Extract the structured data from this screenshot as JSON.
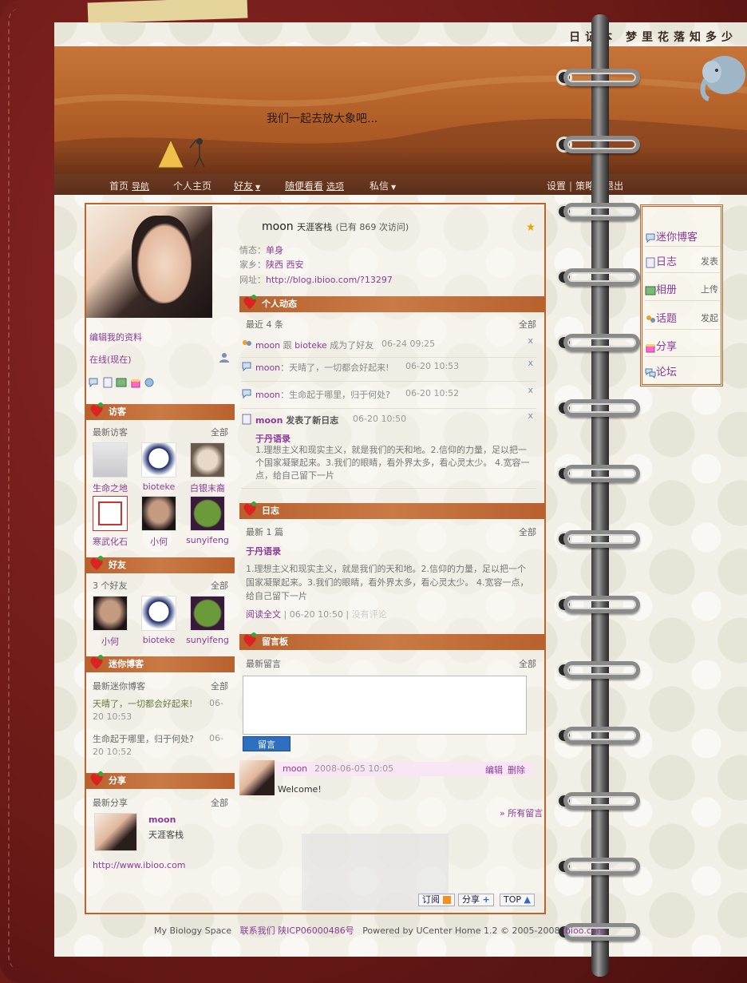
{
  "header": {
    "site_title": "日记本 梦里花落知多少",
    "slogan": "我们一起去放大象吧...",
    "nav_left": [
      {
        "label": "首页",
        "sub": "导航"
      },
      {
        "label": "个人主页"
      },
      {
        "label": "好友",
        "caret": "▼"
      },
      {
        "label": "随便看看",
        "sub": "选项"
      },
      {
        "label": "私信",
        "caret": "▼"
      }
    ],
    "nav_right": [
      "设置",
      "策略",
      "退出"
    ],
    "nav_sep": "|"
  },
  "profile": {
    "name": "moon",
    "title": "天涯客栈",
    "visits": "(已有 869 次访问)",
    "status_label": "情态：",
    "status_value": "单身",
    "hometown_label": "家乡：",
    "hometown_value": "陕西 西安",
    "url_label": "网址：",
    "url_value": "http://blog.ibioo.com/?13297",
    "edit_link": "编辑我的资料",
    "online": "在线(现在)"
  },
  "visitors": {
    "title": "访客",
    "subtitle": "最新访客",
    "all": "全部",
    "items": [
      "生命之地",
      "bioteke",
      "白银末裔",
      "寒武化石",
      "小何",
      "sunyifeng"
    ]
  },
  "friends": {
    "title": "好友",
    "subtitle": "3 个好友",
    "all": "全部",
    "items": [
      "小何",
      "bioteke",
      "sunyifeng"
    ]
  },
  "mini_blog": {
    "title": "迷你博客",
    "subtitle": "最新迷你博客",
    "all": "全部",
    "items": [
      {
        "text": "天晴了，一切都会好起来!",
        "time1": "06-",
        "time2": "20 10:53"
      },
      {
        "text": "生命起于哪里，归于何处?",
        "time1": "06-",
        "time2": "20 10:52"
      }
    ]
  },
  "share": {
    "title": "分享",
    "subtitle": "最新分享",
    "all": "全部",
    "user": "moon",
    "user_title": "天涯客栈",
    "link": "http://www.ibioo.com"
  },
  "feed": {
    "title": "个人动态",
    "subtitle": "最近 4 条",
    "all": "全部",
    "close": "x",
    "items": [
      {
        "user": "moon",
        "join": "跟",
        "target": "bioteke",
        "action": "成为了好友",
        "time": "06-24 09:25"
      },
      {
        "user": "moon",
        "text": "：天晴了，一切都会好起来!",
        "time": "06-20 10:53"
      },
      {
        "user": "moon",
        "text": "：生命起于哪里，归于何处?",
        "time": "06-20 10:52"
      },
      {
        "user": "moon",
        "action": "发表了新日志",
        "time": "06-20 10:50"
      }
    ],
    "post_title": "于丹语录",
    "post_body": "1.理想主义和现实主义，就是我们的天和地。2.信仰的力量，足以把一个国家凝聚起来。3.我们的眼睛，看外界太多，看心灵太少。 4.宽容一点，给自己留下一片"
  },
  "diary": {
    "title": "日志",
    "subtitle": "最新 1 篇",
    "all": "全部",
    "post_title": "于丹语录",
    "post_body": "1.理想主义和现实主义，就是我们的天和地。2.信仰的力量，足以把一个国家凝聚起来。3.我们的眼睛，看外界太多，看心灵太少。 4.宽容一点，给自己留下一片",
    "read_more": "阅读全文",
    "time": "06-20 10:50",
    "sep": "|",
    "comments": "没有评论"
  },
  "guestbook": {
    "title": "留言板",
    "subtitle": "最新留言",
    "all": "全部",
    "submit": "留言",
    "entry_user": "moon",
    "entry_time": "2008-06-05 10:05",
    "entry_edit": "编辑",
    "entry_delete": "删除",
    "entry_text": "Welcome!",
    "all_link": "» 所有留言"
  },
  "sidebar": {
    "items": [
      {
        "label": "迷你博客",
        "aux": ""
      },
      {
        "label": "日志",
        "aux": "发表"
      },
      {
        "label": "相册",
        "aux": "上传"
      },
      {
        "label": "话题",
        "aux": "发起"
      },
      {
        "label": "分享",
        "aux": ""
      },
      {
        "label": "论坛",
        "aux": ""
      }
    ]
  },
  "bottom_buttons": [
    "订阅",
    "分享",
    "TOP"
  ],
  "footer": {
    "site": "My Biology Space",
    "contact": "联系我们",
    "icp": "陕ICP06000486号",
    "powered": "Powered by",
    "product": "UCenter Home",
    "version": "1.2 © 2005-2008",
    "brand": "ibioo.com"
  },
  "colors": {
    "accent": "#c0632a",
    "link": "#8a3c9a",
    "cover": "#6b1c18",
    "paper": "#f2f0e6"
  }
}
